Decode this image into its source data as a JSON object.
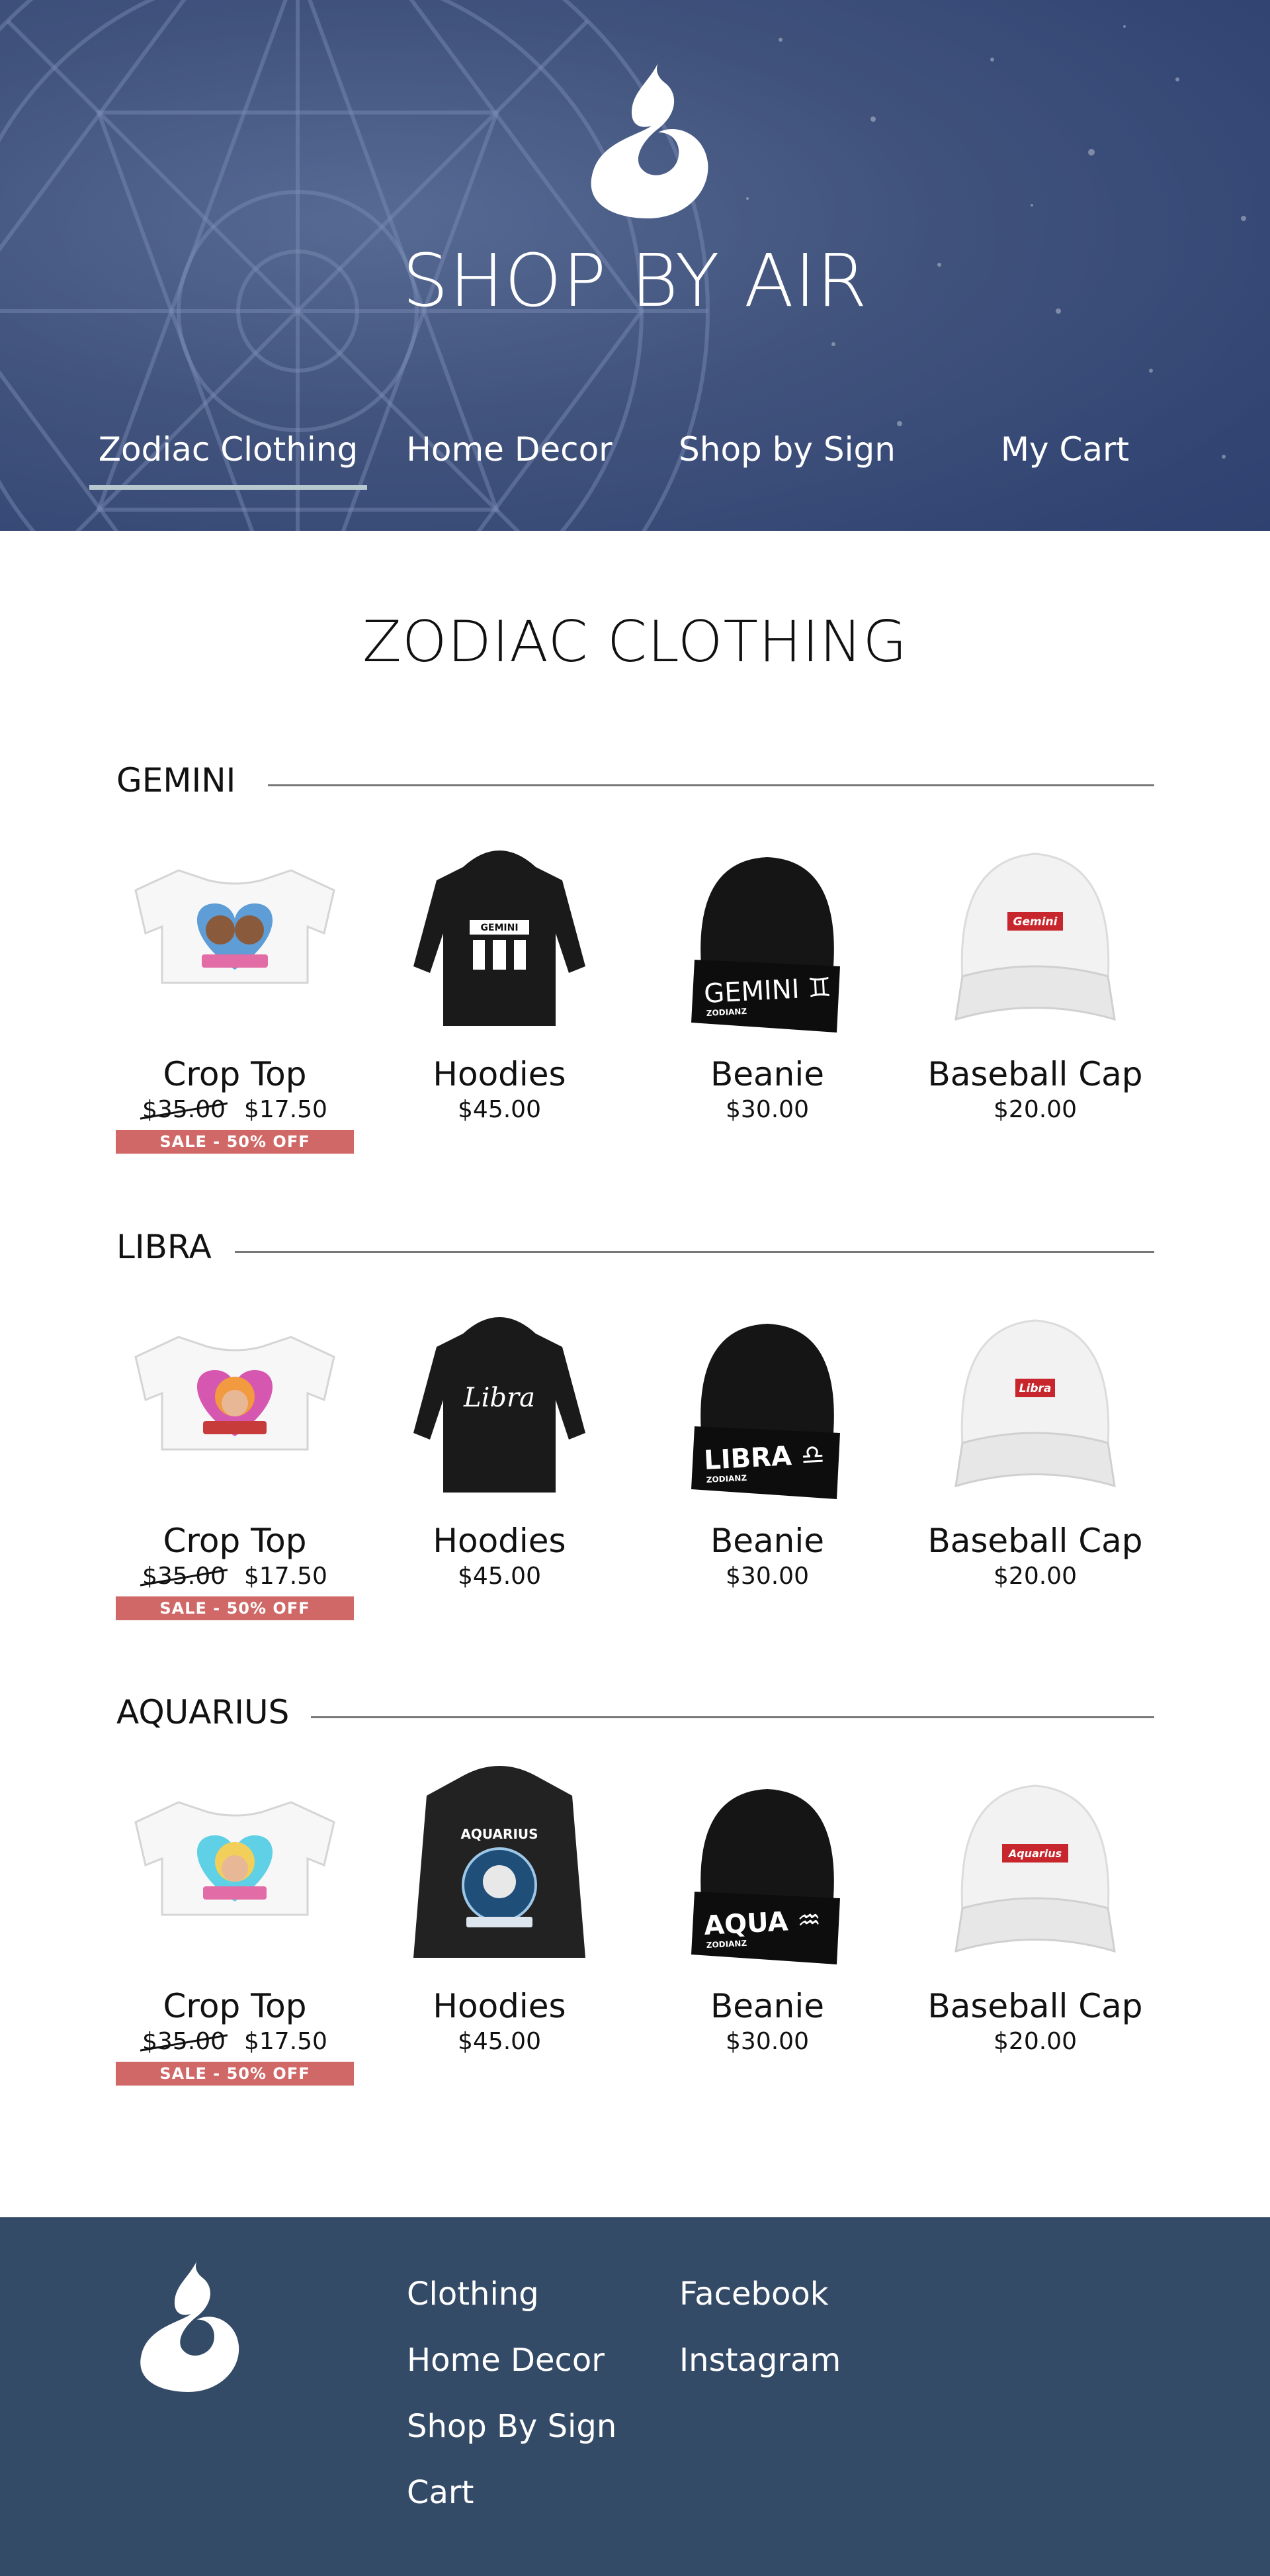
{
  "header": {
    "brand": "SHOP BY AIR",
    "nav": [
      {
        "label": "Zodiac Clothing",
        "active": true
      },
      {
        "label": "Home Decor"
      },
      {
        "label": "Shop by Sign"
      },
      {
        "label": "My Cart"
      }
    ]
  },
  "main": {
    "title": "ZODIAC CLOTHING",
    "sections": [
      {
        "sign": "GEMINI",
        "products": [
          {
            "name": "Crop Top",
            "old_price": "$35.00",
            "price": "$17.50",
            "badge": "SALE - 50% OFF"
          },
          {
            "name": "Hoodies",
            "price": "$45.00",
            "print": "GEMINI"
          },
          {
            "name": "Beanie",
            "price": "$30.00",
            "print": "GEMINI ♊",
            "sub": "ZODIANZ"
          },
          {
            "name": "Baseball Cap",
            "price": "$20.00",
            "print": "Gemini"
          }
        ]
      },
      {
        "sign": "LIBRA",
        "products": [
          {
            "name": "Crop Top",
            "old_price": "$35.00",
            "price": "$17.50",
            "badge": "SALE - 50% OFF"
          },
          {
            "name": "Hoodies",
            "price": "$45.00",
            "print": "Libra"
          },
          {
            "name": "Beanie",
            "price": "$30.00",
            "print": "LIBRA ♎",
            "sub": "ZODIANZ"
          },
          {
            "name": "Baseball Cap",
            "price": "$20.00",
            "print": "Libra"
          }
        ]
      },
      {
        "sign": "AQUARIUS",
        "products": [
          {
            "name": "Crop Top",
            "old_price": "$35.00",
            "price": "$17.50",
            "badge": "SALE - 50% OFF"
          },
          {
            "name": "Hoodies",
            "price": "$45.00",
            "print": "AQUARIUS"
          },
          {
            "name": "Beanie",
            "price": "$30.00",
            "print": "AQUA ♒",
            "sub": "ZODIANZ"
          },
          {
            "name": "Baseball Cap",
            "price": "$20.00",
            "print": "Aquarius"
          }
        ]
      }
    ]
  },
  "footer": {
    "links": [
      "Clothing",
      "Home Decor",
      "Shop By Sign",
      "Cart"
    ],
    "social": [
      "Facebook",
      "Instagram"
    ]
  },
  "colors": {
    "header_bg": "#3a4d78",
    "nav_underline": "#b7c8cf",
    "sale_badge": "#d06868",
    "footer_bg": "#344b68",
    "cap_patch": "#c8262d"
  },
  "icons": [
    "air-element-logo",
    "zodiac-wheel-background"
  ]
}
